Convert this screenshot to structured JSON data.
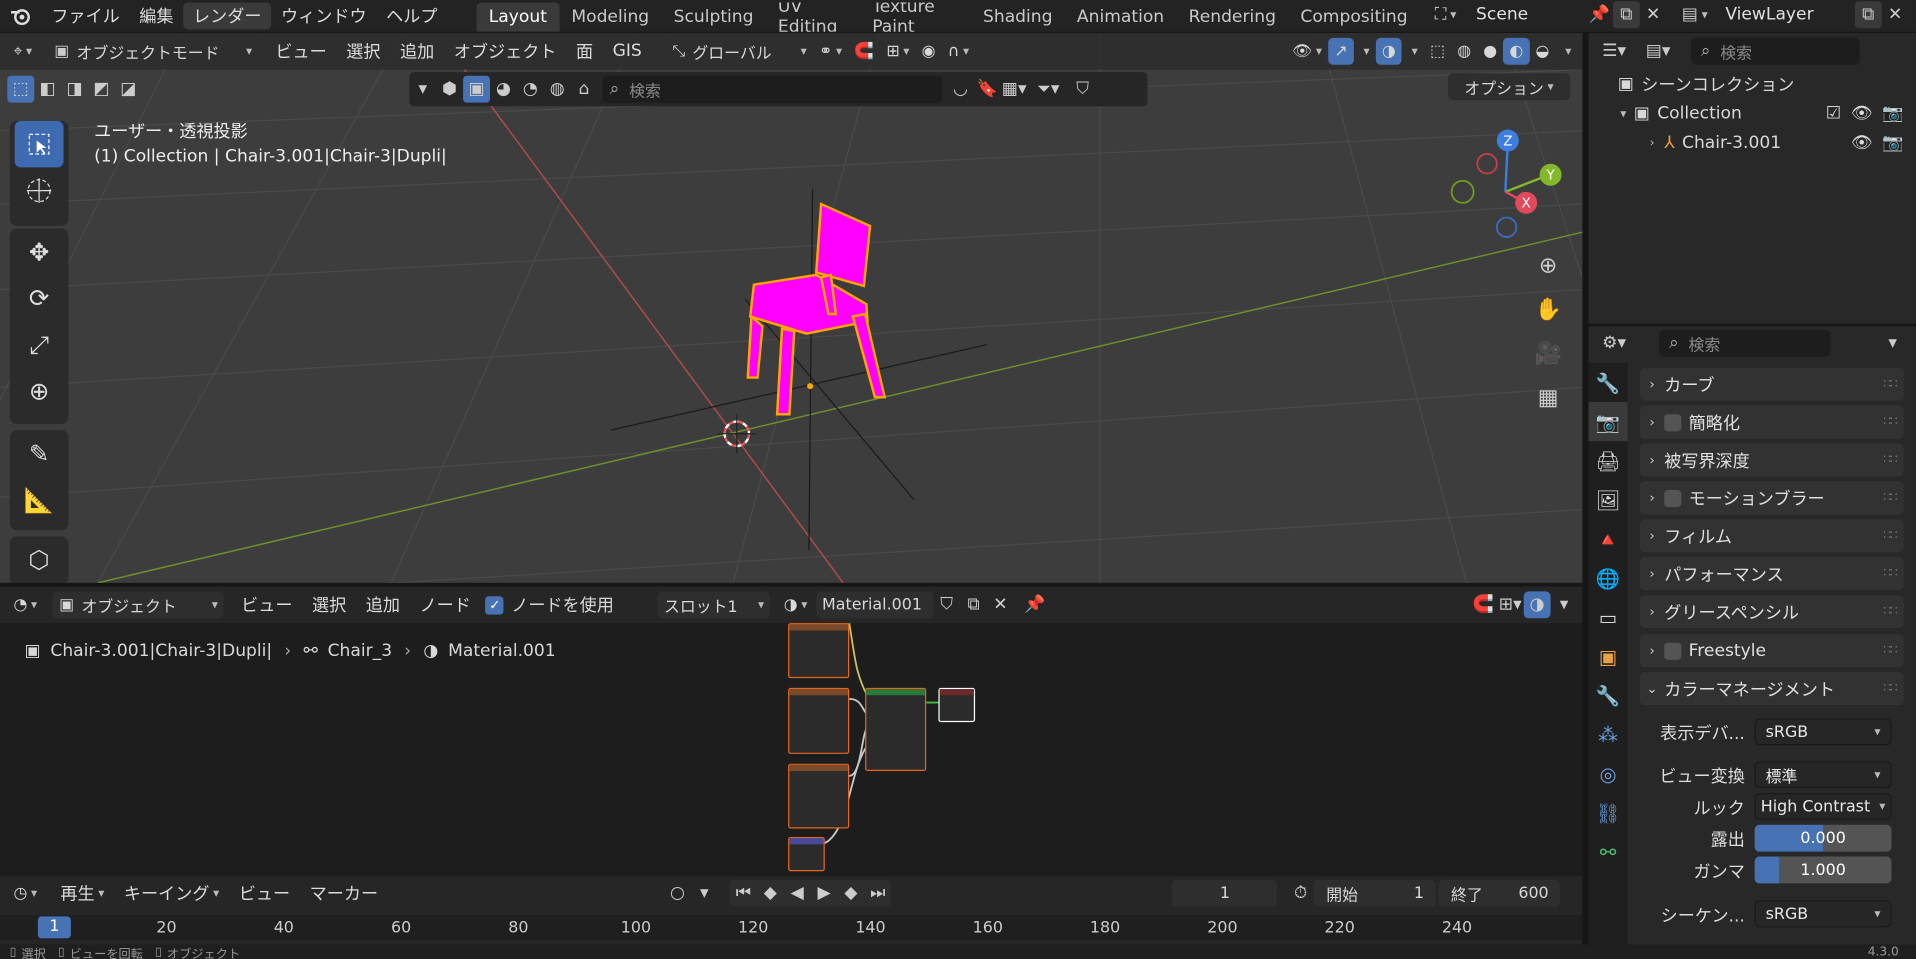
{
  "topbar": {
    "menus": [
      "ファイル",
      "編集",
      "レンダー",
      "ウィンドウ",
      "ヘルプ"
    ],
    "workspaces": [
      "Layout",
      "Modeling",
      "Sculpting",
      "UV Editing",
      "Texture Paint",
      "Shading",
      "Animation",
      "Rendering",
      "Compositing"
    ],
    "active_workspace": "Layout",
    "scene": "Scene",
    "view_layer": "ViewLayer"
  },
  "viewport": {
    "mode": "オブジェクトモード",
    "menus": [
      "ビュー",
      "選択",
      "追加",
      "オブジェクト",
      "面",
      "GIS"
    ],
    "transform": "グローバル",
    "search_placeholder": "検索",
    "options": "オプション",
    "overlay_title": "ユーザー・透視投影",
    "overlay_sub": "(1) Collection | Chair-3.001|Chair-3|Dupli|",
    "gizmo": {
      "z": "Z",
      "y": "Y",
      "x": "X"
    }
  },
  "node_editor": {
    "type": "オブジェクト",
    "menus": [
      "ビュー",
      "選択",
      "追加",
      "ノード"
    ],
    "use_nodes": "ノードを使用",
    "slot": "スロット1",
    "material": "Material.001",
    "breadcrumb": [
      "Chair-3.001|Chair-3|Dupli|",
      "Chair_3",
      "Material.001"
    ]
  },
  "timeline": {
    "menus": [
      "再生",
      "キーイング",
      "ビュー",
      "マーカー"
    ],
    "current_frame": "1",
    "start_label": "開始",
    "start": "1",
    "end_label": "終了",
    "end": "600",
    "ticks": [
      "1",
      "20",
      "40",
      "60",
      "80",
      "100",
      "120",
      "140",
      "160",
      "180",
      "200",
      "220",
      "240"
    ]
  },
  "statusbar": {
    "items": [
      "選択",
      "ビューを回転",
      "オブジェクト"
    ],
    "version": "4.3.0"
  },
  "outliner": {
    "search_placeholder": "検索",
    "scene_collection": "シーンコレクション",
    "collection": "Collection",
    "object": "Chair-3.001"
  },
  "properties": {
    "search_placeholder": "検索",
    "panels": [
      {
        "label": "カーブ",
        "checkbox": false
      },
      {
        "label": "簡略化",
        "checkbox": true
      },
      {
        "label": "被写界深度",
        "checkbox": false
      },
      {
        "label": "モーションブラー",
        "checkbox": true
      },
      {
        "label": "フィルム",
        "checkbox": false
      },
      {
        "label": "パフォーマンス",
        "checkbox": false
      },
      {
        "label": "グリースペンシル",
        "checkbox": false
      },
      {
        "label": "Freestyle",
        "checkbox": true
      }
    ],
    "color_management": {
      "label": "カラーマネージメント",
      "display_label": "表示デバ...",
      "display_value": "sRGB",
      "view_label": "ビュー変換",
      "view_value": "標準",
      "look_label": "ルック",
      "look_value": "High Contrast",
      "exposure_label": "露出",
      "exposure_value": "0.000",
      "gamma_label": "ガンマ",
      "gamma_value": "1.000",
      "sequencer_label": "シーケン...",
      "sequencer_value": "sRGB"
    }
  },
  "colors": {
    "accent": "#4772b3",
    "selection_magenta": "#ff00ff",
    "node_outline": "#e8651c"
  }
}
